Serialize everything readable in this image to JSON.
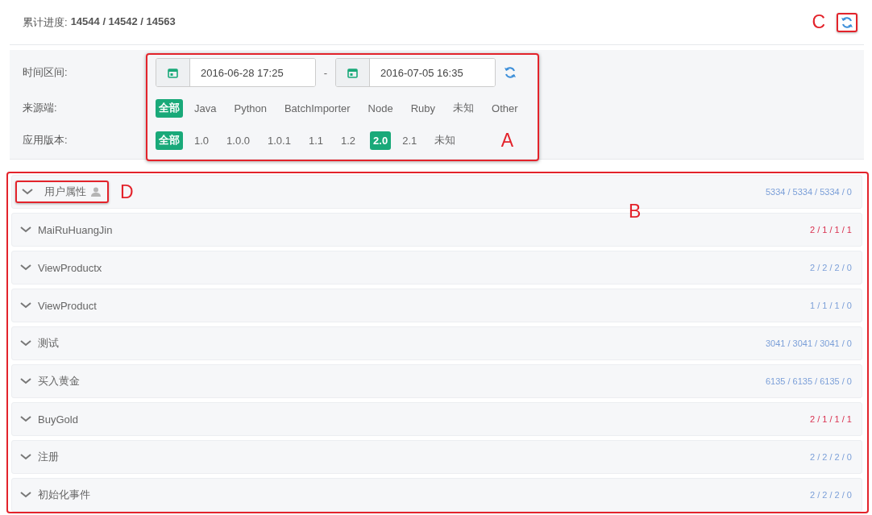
{
  "header": {
    "progress_label": "累计进度:",
    "progress_value": "14544 / 14542 / 14563",
    "annotation": "C"
  },
  "filters": {
    "annotation": "A",
    "time_label": "时间区间:",
    "start": "2016-06-28 17:25",
    "separator": "-",
    "end": "2016-07-05 16:35",
    "source_label": "来源端:",
    "sources": [
      {
        "label": "全部",
        "selected": true
      },
      {
        "label": "Java",
        "selected": false
      },
      {
        "label": "Python",
        "selected": false
      },
      {
        "label": "BatchImporter",
        "selected": false
      },
      {
        "label": "Node",
        "selected": false
      },
      {
        "label": "Ruby",
        "selected": false
      },
      {
        "label": "未知",
        "selected": false
      },
      {
        "label": "Other",
        "selected": false
      }
    ],
    "version_label": "应用版本:",
    "versions": [
      {
        "label": "全部",
        "selected": true
      },
      {
        "label": "1.0",
        "selected": false
      },
      {
        "label": "1.0.0",
        "selected": false
      },
      {
        "label": "1.0.1",
        "selected": false
      },
      {
        "label": "1.1",
        "selected": false
      },
      {
        "label": "1.2",
        "selected": false
      },
      {
        "label": "2.0",
        "selected": true
      },
      {
        "label": "2.1",
        "selected": false
      },
      {
        "label": "未知",
        "selected": false
      }
    ]
  },
  "events": {
    "annotation": "B",
    "rows": [
      {
        "title": "用户属性",
        "kind": "user-property",
        "annotation": "D",
        "counts": "5334 / 5334 / 5334 / 0",
        "color": "#7b9fd8"
      },
      {
        "title": "MaiRuHuangJin",
        "kind": "event",
        "counts": "2 / 1 / 1 / 1",
        "color": "#d9304f"
      },
      {
        "title": "ViewProductx",
        "kind": "event",
        "counts": "2 / 2 / 2 / 0",
        "color": "#7b9fd8"
      },
      {
        "title": "ViewProduct",
        "kind": "event",
        "counts": "1 / 1 / 1 / 0",
        "color": "#7b9fd8"
      },
      {
        "title": "测试",
        "kind": "event",
        "counts": "3041 / 3041 / 3041 / 0",
        "color": "#7b9fd8"
      },
      {
        "title": "买入黄金",
        "kind": "event",
        "counts": "6135 / 6135 / 6135 / 0",
        "color": "#7b9fd8"
      },
      {
        "title": "BuyGold",
        "kind": "event",
        "counts": "2 / 1 / 1 / 1",
        "color": "#d9304f"
      },
      {
        "title": "注册",
        "kind": "event",
        "counts": "2 / 2 / 2 / 0",
        "color": "#7b9fd8"
      },
      {
        "title": "初始化事件",
        "kind": "event",
        "counts": "2 / 2 / 2 / 0",
        "color": "#7b9fd8"
      }
    ]
  }
}
